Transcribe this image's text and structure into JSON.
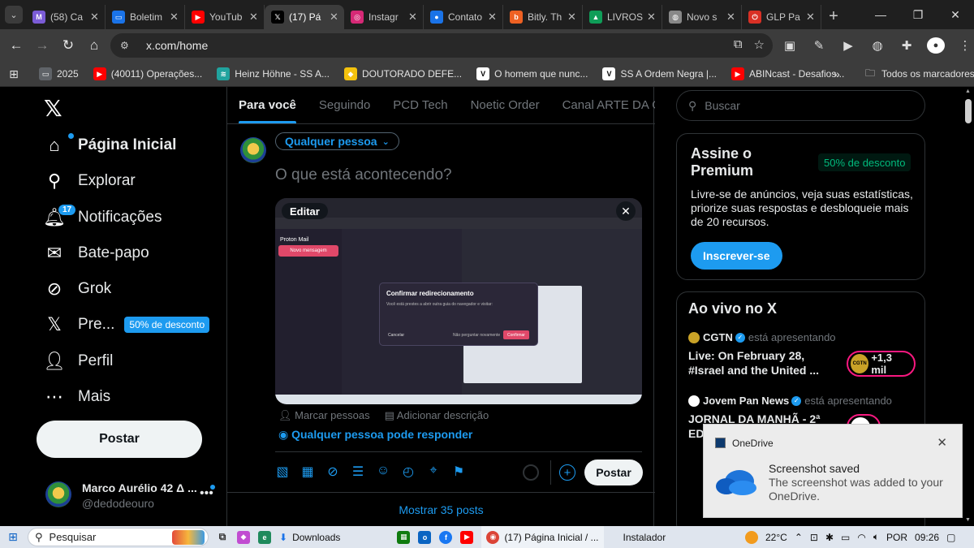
{
  "browser": {
    "tabs": [
      {
        "title": "(58) Ca",
        "icon": "gmail-icon",
        "color": "#7b5cd6"
      },
      {
        "title": "Boletim",
        "icon": "monitor-icon",
        "color": "#1a73e8"
      },
      {
        "title": "YouTub",
        "icon": "youtube-icon",
        "color": "#ff0000"
      },
      {
        "title": "(17) Pá",
        "icon": "x-icon",
        "color": "#000000"
      },
      {
        "title": "Instagr",
        "icon": "instagram-icon",
        "color": "#d62976"
      },
      {
        "title": "Contato",
        "icon": "person-icon",
        "color": "#1a73e8"
      },
      {
        "title": "Bitly. Th",
        "icon": "bitly-icon",
        "color": "#ee6123"
      },
      {
        "title": "LIVROS",
        "icon": "drive-icon",
        "color": "#0f9d58"
      },
      {
        "title": "Novo s",
        "icon": "globe-icon",
        "color": "#888888"
      },
      {
        "title": "GLP Pa",
        "icon": "power-icon",
        "color": "#d93025"
      }
    ],
    "active_tab": 3,
    "url": "x.com/home",
    "bookmarks": [
      {
        "label": "2025",
        "icon": "folder-icon",
        "color": "#5f6368"
      },
      {
        "label": "(40011) Operações...",
        "icon": "youtube-icon",
        "color": "#ff0000"
      },
      {
        "label": "Heinz Höhne - SS A...",
        "icon": "layers-icon",
        "color": "#20a39e"
      },
      {
        "label": "DOUTORADO DEFE...",
        "icon": "bag-icon",
        "color": "#f4c20d"
      },
      {
        "label": "O homem que nunc...",
        "icon": "v-icon",
        "color": "#ffffff"
      },
      {
        "label": "SS A Ordem Negra |...",
        "icon": "v-icon",
        "color": "#ffffff"
      },
      {
        "label": "ABINcast - Desafios...",
        "icon": "youtube-icon",
        "color": "#ff0000"
      }
    ],
    "bookmarks_all": "Todos os marcadores"
  },
  "nav": {
    "items": [
      {
        "label": "Página Inicial",
        "icon": "home-icon"
      },
      {
        "label": "Explorar",
        "icon": "search-icon"
      },
      {
        "label": "Notificações",
        "icon": "bell-icon",
        "badge": "17"
      },
      {
        "label": "Bate-papo",
        "icon": "mail-icon"
      },
      {
        "label": "Grok",
        "icon": "grok-icon"
      },
      {
        "label": "Pre...",
        "icon": "x-icon",
        "promo": "50% de desconto"
      },
      {
        "label": "Perfil",
        "icon": "person-icon"
      },
      {
        "label": "Mais",
        "icon": "more-circle-icon"
      }
    ],
    "post_button": "Postar",
    "account": {
      "name": "Marco Aurélio 42 Δ ...",
      "handle": "@dedodeouro"
    }
  },
  "feed": {
    "tabs": [
      "Para você",
      "Seguindo",
      "PCD Tech",
      "Noetic Order",
      "Canal ARTE DA GUERRA"
    ],
    "audience": "Qualquer pessoa",
    "prompt": "O que está acontecendo?",
    "media": {
      "edit": "Editar",
      "preview_app": "Proton Mail",
      "preview_new_message": "Novo mensagem",
      "preview_dialog_title": "Confirmar redirecionamento",
      "preview_dialog_text": "Você está prestes a abrir outra guia do navegador e visitar:",
      "preview_cancel": "Cancelar",
      "preview_no_ask": "Não perguntar novamente",
      "preview_confirm": "Confirmar"
    },
    "media_actions": [
      "Marcar pessoas",
      "Adicionar descrição"
    ],
    "reply_setting": "Qualquer pessoa pode responder",
    "post_button": "Postar",
    "show_more": "Mostrar 35 posts"
  },
  "right": {
    "search_placeholder": "Buscar",
    "premium": {
      "title": "Assine o Premium",
      "discount": "50% de desconto",
      "desc": "Livre-se de anúncios, veja suas estatísticas, priorize suas respostas e desbloqueie mais de 20 recursos.",
      "button": "Inscrever-se"
    },
    "live": {
      "title": "Ao vivo no X",
      "presenting": "está apresentando",
      "items": [
        {
          "host": "CGTN",
          "title": "Live: On February 28, #Israel and the United ...",
          "count": "+1,3 mil"
        },
        {
          "host": "Jovem Pan News",
          "title": "JORNAL DA MANHÃ - 2ª ED",
          "count": ""
        }
      ]
    }
  },
  "toast": {
    "app": "OneDrive",
    "title": "Screenshot saved",
    "message": "The screenshot was added to your OneDrive."
  },
  "taskbar": {
    "search": "Pesquisar",
    "downloads": "Downloads",
    "chrome_window": "(17) Página Inicial / ...",
    "installer": "Instalador",
    "weather": "22°C",
    "lang": "POR",
    "time": "09:26"
  }
}
